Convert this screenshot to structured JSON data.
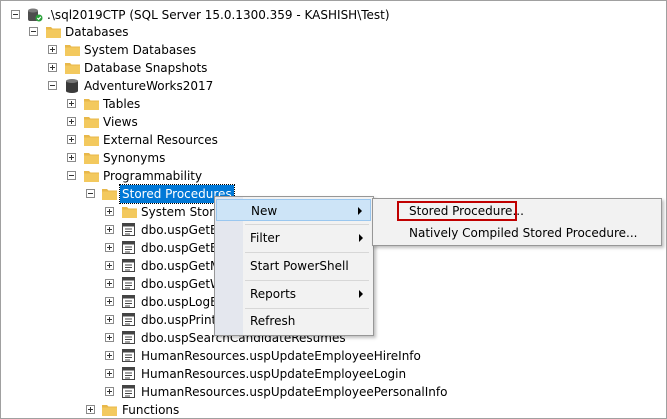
{
  "tree": {
    "server": ".\\sql2019CTP (SQL Server 15.0.1300.359 - KASHISH\\Test)",
    "databases": "Databases",
    "system_databases": "System Databases",
    "database_snapshots": "Database Snapshots",
    "adventureworks": "AdventureWorks2017",
    "tables": "Tables",
    "views": "Views",
    "external_resources": "External Resources",
    "synonyms": "Synonyms",
    "programmability": "Programmability",
    "stored_procedures": "Stored Procedures",
    "procs": [
      "System Stored",
      "dbo.uspGetBil",
      "dbo.uspGetEm",
      "dbo.uspGetM",
      "dbo.uspGetW",
      "dbo.uspLogEr",
      "dbo.uspPrintE",
      "dbo.uspSearchCandidateResumes",
      "HumanResources.uspUpdateEmployeeHireInfo",
      "HumanResources.uspUpdateEmployeeLogin",
      "HumanResources.uspUpdateEmployeePersonalInfo"
    ],
    "functions": "Functions"
  },
  "context_menu": {
    "new": "New",
    "filter": "Filter",
    "start_powershell": "Start PowerShell",
    "reports": "Reports",
    "refresh": "Refresh"
  },
  "submenu": {
    "stored_procedure": "Stored Procedure...",
    "natively_compiled": "Natively Compiled Stored Procedure..."
  },
  "colors": {
    "selection": "#0078d7",
    "highlight_box": "#c00000",
    "folder": "#e8b84a"
  }
}
